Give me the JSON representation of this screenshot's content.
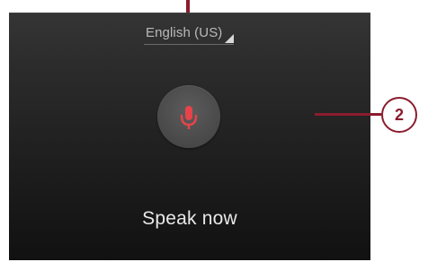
{
  "language_selector": {
    "label": "English (US)"
  },
  "voice_input": {
    "prompt": "Speak now",
    "mic_color": "#e8434a"
  },
  "callouts": {
    "right_number": "2",
    "color": "#8b1c2e"
  }
}
